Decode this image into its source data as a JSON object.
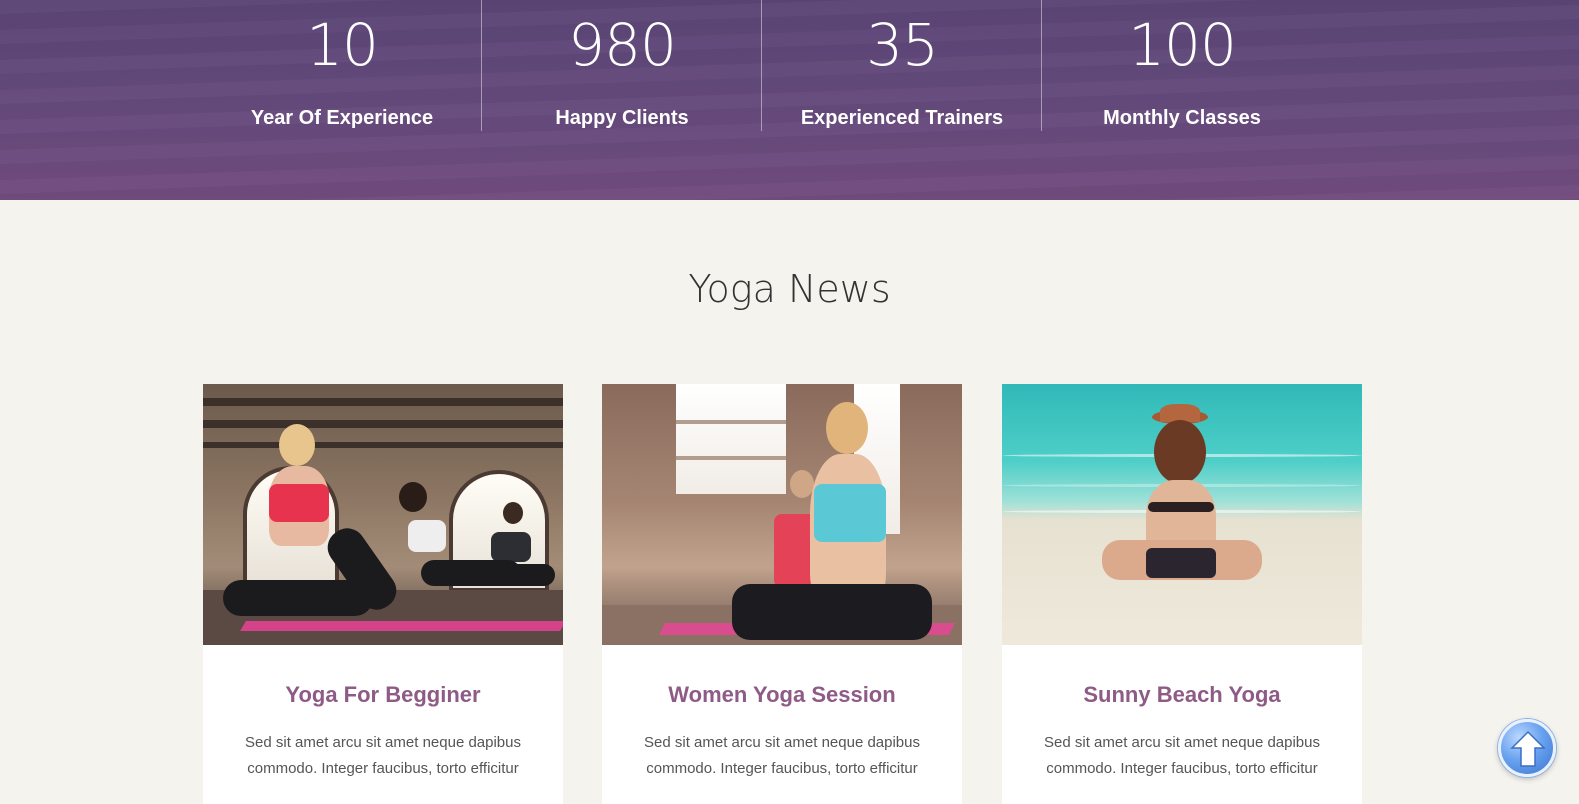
{
  "stats": [
    {
      "number": "10",
      "label": "Year Of Experience"
    },
    {
      "number": "980",
      "label": "Happy Clients"
    },
    {
      "number": "35",
      "label": "Experienced Trainers"
    },
    {
      "number": "100",
      "label": "Monthly Classes"
    }
  ],
  "news": {
    "title": "Yoga News",
    "cards": [
      {
        "title": "Yoga For Begginer",
        "text": "Sed sit amet arcu sit amet neque dapibus commodo. Integer faucibus, torto efficitur"
      },
      {
        "title": "Women Yoga Session",
        "text": "Sed sit amet arcu sit amet neque dapibus commodo. Integer faucibus, torto efficitur"
      },
      {
        "title": "Sunny Beach Yoga",
        "text": "Sed sit amet arcu sit amet neque dapibus commodo. Integer faucibus, torto efficitur"
      }
    ]
  },
  "icons": {
    "back_to_top": "arrow-up-icon"
  },
  "colors": {
    "stats_band": "#5e4678",
    "card_title": "#8e5b86",
    "page_bg": "#f5f3ee"
  }
}
